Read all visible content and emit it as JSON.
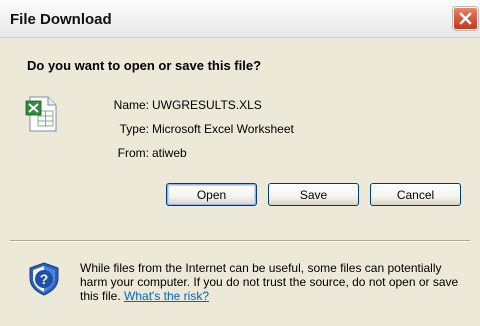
{
  "window": {
    "title": "File Download",
    "close_icon": "close-icon",
    "close_color": "#d9553a"
  },
  "prompt": {
    "heading": "Do you want to open or save this file?"
  },
  "file": {
    "icon": "excel-file-icon",
    "name_label": "Name:",
    "name_value": "UWGRESULTS.XLS",
    "type_label": "Type:",
    "type_value": "Microsoft Excel Worksheet",
    "from_label": "From:",
    "from_value": "atiweb"
  },
  "buttons": {
    "open_label": "Open",
    "save_label": "Save",
    "cancel_label": "Cancel"
  },
  "warning": {
    "icon": "security-shield-icon",
    "text": "While files from the Internet can be useful, some files can potentially harm your computer. If you do not trust the source, do not open or save this file.",
    "link_text": "What's the risk?",
    "link_color": "#0066cc"
  }
}
